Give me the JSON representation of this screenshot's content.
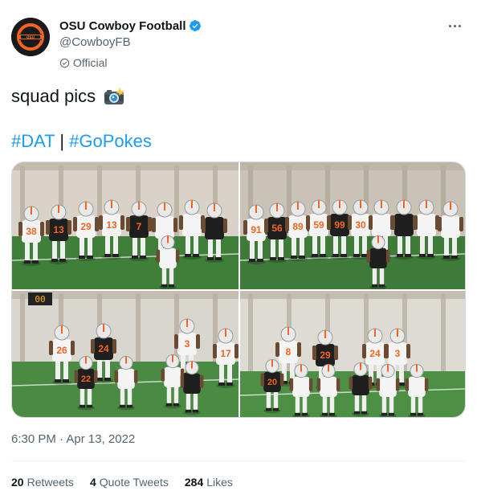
{
  "author": {
    "display_name": "OSU Cowboy Football",
    "handle": "@CowboyFB",
    "badge_label": "Official",
    "avatar_icon": "osu-brand-logo",
    "verified_icon": "verified-badge-icon"
  },
  "tweet": {
    "text": "squad pics",
    "emoji": "camera-with-flash-icon",
    "hashtag_1": "#DAT",
    "separator": " | ",
    "hashtag_2": "#GoPokes",
    "timestamp": "6:30 PM · Apr 13, 2022"
  },
  "media": {
    "photos": [
      {
        "jerseys": [
          "38",
          "13",
          "29",
          "13",
          "7"
        ]
      },
      {
        "jerseys": [
          "91",
          "56",
          "89",
          "59",
          "99",
          "30"
        ]
      },
      {
        "jerseys": [
          "26",
          "24",
          "3",
          "17",
          "22"
        ]
      },
      {
        "jerseys": [
          "8",
          "29",
          "24",
          "3",
          "20"
        ]
      }
    ],
    "scoreboard": "00"
  },
  "stats": {
    "retweets_count": "20",
    "retweets_label": "Retweets",
    "quotes_count": "4",
    "quotes_label": "Quote Tweets",
    "likes_count": "284",
    "likes_label": "Likes"
  },
  "colors": {
    "brand_orange": "#f26522",
    "link_blue": "#1d9bf0",
    "verified_blue": "#1d9bf0",
    "text_primary": "#0f1419",
    "text_secondary": "#536471"
  }
}
